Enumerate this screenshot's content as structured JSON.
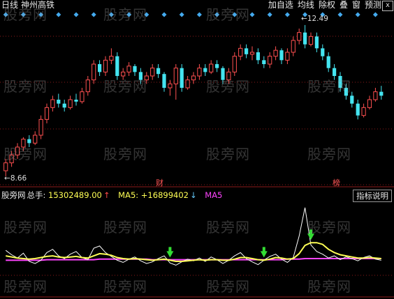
{
  "header": {
    "period": "日线",
    "stock_name": "神州高铁",
    "tools": [
      "加自选",
      "均线",
      "除权",
      "叠",
      "窗",
      "预测"
    ],
    "close_symbol": "x"
  },
  "price_chart": {
    "high_label": "12.49",
    "low_label": "8.66",
    "events": [
      "财",
      "榜"
    ]
  },
  "indicator": {
    "name": "股旁网",
    "label": "总手:",
    "value": "15302489.00",
    "ma5_label": "MA5:",
    "ma5_value": "+16899402",
    "ma5_label_2": "MA5",
    "help": "指标说明"
  },
  "watermark": "股旁网",
  "colors": {
    "background": "#000000",
    "up": "#ff5050",
    "down": "#44e4f0",
    "volume": "#ffffff",
    "ma5_line": "#ffff55",
    "ma5b_line": "#ff44ff",
    "signal": "#33dd33",
    "diamond": "#44aaee"
  },
  "chart_data": {
    "type": "candlestick",
    "candles": [
      [
        8.8,
        9.0,
        8.66,
        9.1
      ],
      [
        9.0,
        9.2,
        8.9,
        9.3
      ],
      [
        9.2,
        9.4,
        9.1,
        9.5
      ],
      [
        9.4,
        9.6,
        9.3,
        9.65
      ],
      [
        9.6,
        9.5,
        9.4,
        9.7
      ],
      [
        9.5,
        9.7,
        9.45,
        9.8
      ],
      [
        9.7,
        10.1,
        9.6,
        10.2
      ],
      [
        10.1,
        10.4,
        10.0,
        10.5
      ],
      [
        10.4,
        10.6,
        10.3,
        10.7
      ],
      [
        10.6,
        10.5,
        10.4,
        10.75
      ],
      [
        10.5,
        10.4,
        10.3,
        10.6
      ],
      [
        10.4,
        10.6,
        10.35,
        10.7
      ],
      [
        10.6,
        10.55,
        10.45,
        10.75
      ],
      [
        10.55,
        10.8,
        10.5,
        10.9
      ],
      [
        10.8,
        11.1,
        10.7,
        11.2
      ],
      [
        11.1,
        11.5,
        11.0,
        11.6
      ],
      [
        11.5,
        11.3,
        11.2,
        11.6
      ],
      [
        11.3,
        11.6,
        11.2,
        11.7
      ],
      [
        11.6,
        11.7,
        11.5,
        11.9
      ],
      [
        11.7,
        11.2,
        11.1,
        11.8
      ],
      [
        11.2,
        11.3,
        11.1,
        11.4
      ],
      [
        11.3,
        11.45,
        11.2,
        11.55
      ],
      [
        11.45,
        11.3,
        11.2,
        11.5
      ],
      [
        11.3,
        11.1,
        11.0,
        11.4
      ],
      [
        11.1,
        11.2,
        11.0,
        11.3
      ],
      [
        11.2,
        11.4,
        11.1,
        11.5
      ],
      [
        11.4,
        11.25,
        11.15,
        11.5
      ],
      [
        11.25,
        10.9,
        10.8,
        11.3
      ],
      [
        10.9,
        11.0,
        10.7,
        11.1
      ],
      [
        11.0,
        11.4,
        10.6,
        11.5
      ],
      [
        11.4,
        10.9,
        10.8,
        11.5
      ],
      [
        10.9,
        11.1,
        10.85,
        11.2
      ],
      [
        11.1,
        11.2,
        11.0,
        11.3
      ],
      [
        11.2,
        11.4,
        11.1,
        11.5
      ],
      [
        11.4,
        11.3,
        11.2,
        11.5
      ],
      [
        11.3,
        11.5,
        11.25,
        11.6
      ],
      [
        11.5,
        11.4,
        11.3,
        11.6
      ],
      [
        11.4,
        11.1,
        11.0,
        11.45
      ],
      [
        11.1,
        11.3,
        11.0,
        11.4
      ],
      [
        11.3,
        11.7,
        11.2,
        11.8
      ],
      [
        11.7,
        11.9,
        11.6,
        12.0
      ],
      [
        11.9,
        11.75,
        11.65,
        12.0
      ],
      [
        11.75,
        11.8,
        11.6,
        11.95
      ],
      [
        11.8,
        11.6,
        11.5,
        11.9
      ],
      [
        11.6,
        11.5,
        11.4,
        11.7
      ],
      [
        11.5,
        11.7,
        11.4,
        11.8
      ],
      [
        11.7,
        11.85,
        11.6,
        11.95
      ],
      [
        11.85,
        11.6,
        11.5,
        11.9
      ],
      [
        11.6,
        11.8,
        11.5,
        11.9
      ],
      [
        11.8,
        12.1,
        11.7,
        12.2
      ],
      [
        12.1,
        12.3,
        12.0,
        12.4
      ],
      [
        12.3,
        12.0,
        11.9,
        12.49
      ],
      [
        12.0,
        12.2,
        11.95,
        12.3
      ],
      [
        12.2,
        11.9,
        11.8,
        12.3
      ],
      [
        11.9,
        11.7,
        11.6,
        12.0
      ],
      [
        11.7,
        11.4,
        11.3,
        11.8
      ],
      [
        11.4,
        11.2,
        11.1,
        11.5
      ],
      [
        11.2,
        10.9,
        10.8,
        11.3
      ],
      [
        10.9,
        10.7,
        10.6,
        11.0
      ],
      [
        10.7,
        10.5,
        10.4,
        10.8
      ],
      [
        10.5,
        10.2,
        10.1,
        10.6
      ],
      [
        10.2,
        10.4,
        10.15,
        10.5
      ],
      [
        10.4,
        10.6,
        10.35,
        10.7
      ],
      [
        10.6,
        10.8,
        10.55,
        10.9
      ],
      [
        10.8,
        10.7,
        10.6,
        10.95
      ]
    ],
    "volume": [
      62,
      54,
      48,
      57,
      42,
      38,
      44,
      58,
      64,
      52,
      47,
      55,
      60,
      49,
      45,
      66,
      70,
      58,
      51,
      44,
      40,
      46,
      50,
      43,
      38,
      41,
      47,
      52,
      39,
      35,
      41,
      46,
      43,
      48,
      42,
      50,
      45,
      38,
      44,
      52,
      58,
      47,
      41,
      36,
      44,
      51,
      55,
      46,
      40,
      49,
      88,
      140,
      72,
      60,
      55,
      48,
      52,
      45,
      50,
      47,
      43,
      49,
      52,
      46,
      44
    ],
    "ma5": [
      52,
      50,
      48,
      47,
      46,
      47,
      49,
      51,
      52,
      50,
      49,
      50,
      51,
      49,
      48,
      52,
      56,
      55,
      53,
      49,
      47,
      46,
      47,
      46,
      45,
      44,
      45,
      46,
      44,
      42,
      42,
      43,
      44,
      45,
      44,
      45,
      45,
      44,
      44,
      46,
      49,
      49,
      47,
      45,
      44,
      46,
      49,
      48,
      46,
      47,
      56,
      71,
      76,
      76,
      73,
      64,
      58,
      54,
      52,
      50,
      48,
      48,
      49,
      48,
      47
    ],
    "ma5b": [
      44,
      44,
      44,
      44,
      44,
      44,
      44,
      45,
      45,
      45,
      45,
      45,
      45,
      45,
      45,
      45,
      46,
      46,
      46,
      46,
      46,
      46,
      46,
      46,
      46,
      45,
      45,
      45,
      45,
      45,
      45,
      45,
      45,
      45,
      45,
      45,
      45,
      45,
      45,
      45,
      45,
      45,
      45,
      45,
      45,
      45,
      45,
      45,
      46,
      46,
      46,
      47,
      47,
      47,
      47,
      47,
      47,
      47,
      47,
      47,
      47,
      47,
      47,
      47,
      47
    ],
    "signals": [
      28,
      44,
      52
    ],
    "ylim_price": [
      8.5,
      12.7
    ],
    "ylim_volume": [
      0,
      150
    ]
  }
}
